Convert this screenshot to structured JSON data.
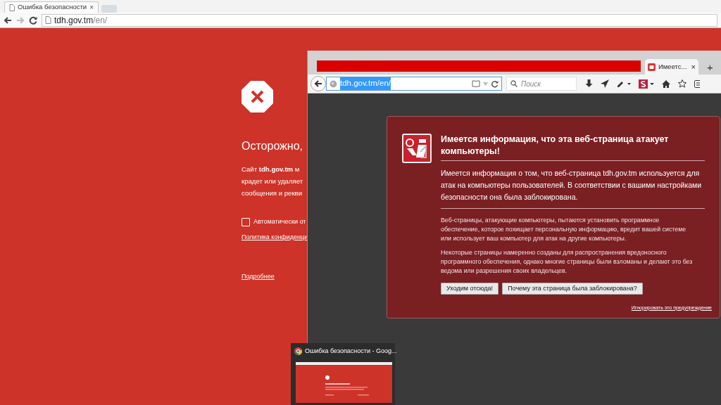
{
  "chrome": {
    "tab": {
      "title": "Ошибка безопасности",
      "close": "×"
    },
    "address": {
      "host": "tdh.gov.tm",
      "path": "/en/"
    },
    "page": {
      "heading": "Осторожно,",
      "lines": [
        "Сайт **tdh.gov.tm** м",
        "крадет или удаляет",
        "сообщения и рекви"
      ],
      "checkbox": {
        "label": "Автоматически от",
        "checked": false
      },
      "privacy_link": "Политика конфиденци",
      "details_link": "Подробнее"
    }
  },
  "firefox": {
    "tab": {
      "title": "Имеетс...",
      "close": "×"
    },
    "new_tab": "+",
    "address": {
      "value": "tdh.gov.tm/en/",
      "selected": true
    },
    "search": {
      "placeholder": "Поиск"
    },
    "error": {
      "title": "Имеется информация, что эта веб-страница атакует компьютеры!",
      "summary": "Имеется информация о том, что веб-страница tdh.gov.tm используется для атак на компьютеры пользователей. В соответствии с вашими настройками безопасности она была заблокирована.",
      "paragraphs": [
        "Веб-страницы, атакующие компьютеры, пытаются установить программное обеспечение, которое похищает персональную информацию, вредит вашей системе или использует ваш компьютер для атак на другие компьютеры.",
        "Некоторые страницы намеренно созданы для распространения вредоносного программного обеспечения, однако многие страницы были взломаны и делают это без ведома или разрешения своих владельцев."
      ],
      "buttons": [
        "Уходим отсюда!",
        "Почему эта страница была заблокирована?"
      ],
      "ignore_link": "Игнорировать это предупреждение"
    }
  },
  "taskbar_preview": {
    "title": "Ошибка безопасности - Goog..."
  }
}
